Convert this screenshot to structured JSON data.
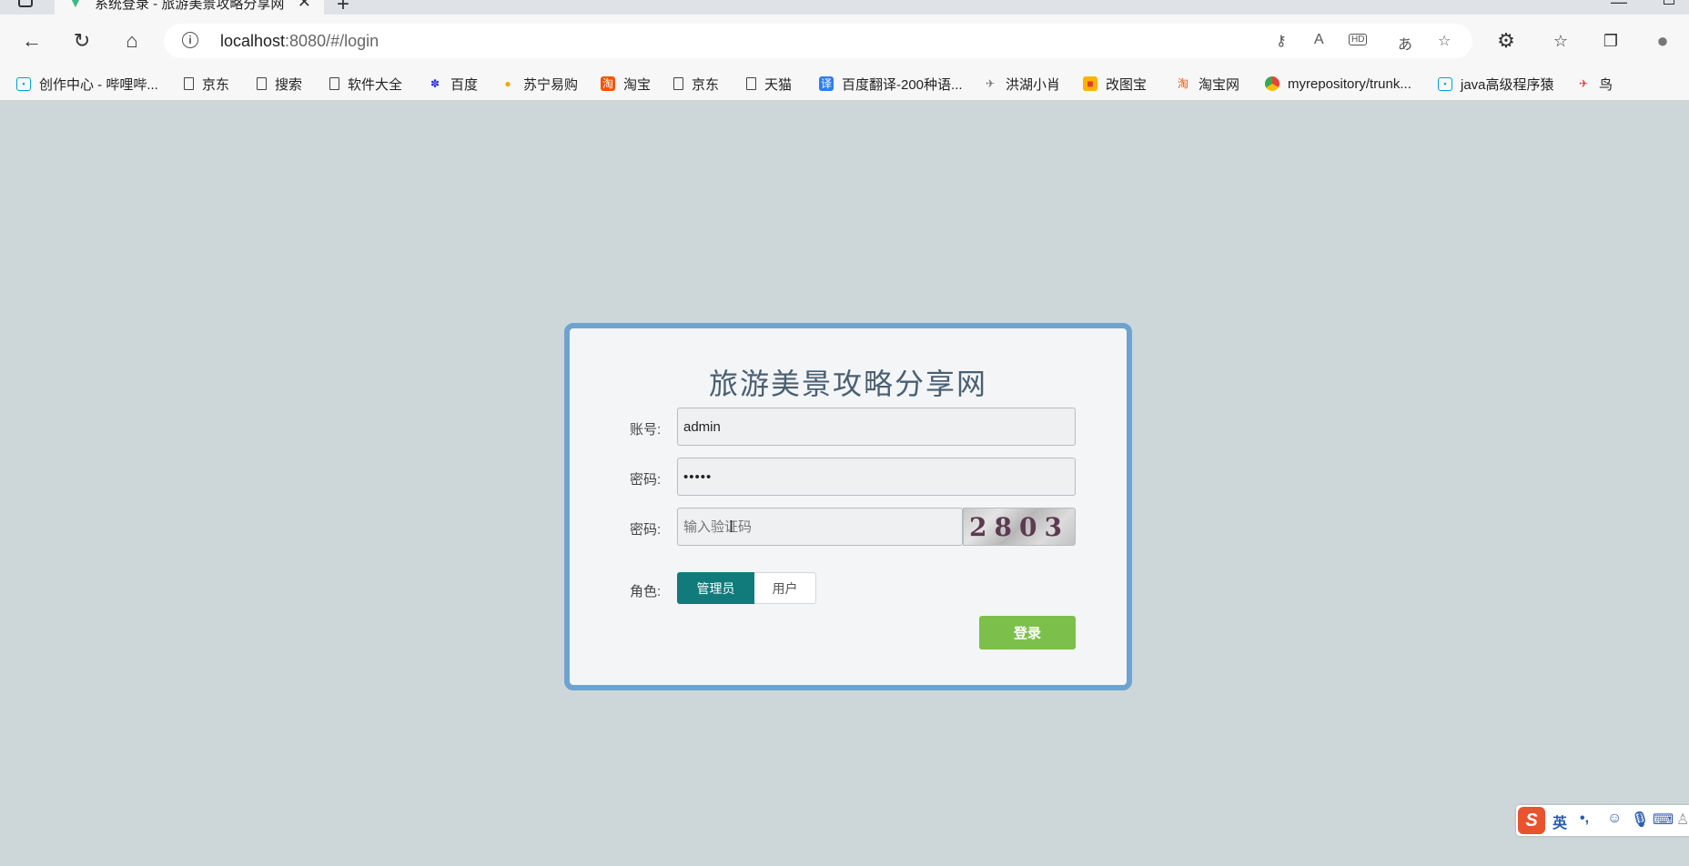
{
  "browser": {
    "tab_title": "系统登录 - 旅游美景攻略分享网",
    "url_host": "localhost",
    "url_path": ":8080/#/login",
    "bookmarks": [
      {
        "label": "创作中心 - 哔哩哔...",
        "icon": "bilibili-icon"
      },
      {
        "label": "京东",
        "icon": "file-icon"
      },
      {
        "label": "搜索",
        "icon": "file-icon"
      },
      {
        "label": "软件大全",
        "icon": "file-icon"
      },
      {
        "label": "百度",
        "icon": "baidu-icon"
      },
      {
        "label": "苏宁易购",
        "icon": "suning-icon"
      },
      {
        "label": "淘宝",
        "icon": "taobao-icon"
      },
      {
        "label": "京东",
        "icon": "file-icon"
      },
      {
        "label": "天猫",
        "icon": "file-icon"
      },
      {
        "label": "百度翻译-200种语...",
        "icon": "baidu-translate-icon"
      },
      {
        "label": "洪湖小肖",
        "icon": "bird-icon"
      },
      {
        "label": "改图宝",
        "icon": "gaitubao-icon"
      },
      {
        "label": "淘宝网",
        "icon": "taobao-icon"
      },
      {
        "label": "myrepository/trunk...",
        "icon": "chrome-icon"
      },
      {
        "label": "java高级程序猿",
        "icon": "bilibili-icon"
      },
      {
        "label": "鸟",
        "icon": "bird-icon"
      }
    ]
  },
  "login": {
    "title": "旅游美景攻略分享网",
    "username_label": "账号:",
    "username_value": "admin",
    "password_label": "密码:",
    "password_value": "•••••",
    "captcha_label": "密码:",
    "captcha_placeholder": "输入验证码",
    "captcha_code": "2803",
    "role_label": "角色:",
    "roles": [
      "管理员",
      "用户"
    ],
    "selected_role": "管理员",
    "login_button": "登录"
  },
  "ime": {
    "logo": "S",
    "mode": "英",
    "punct": "•,"
  },
  "colors": {
    "page_bg": "#cdd7da",
    "card_border": "#6ea3cf",
    "role_active": "#117a7a",
    "login_button": "#7cc04b"
  }
}
